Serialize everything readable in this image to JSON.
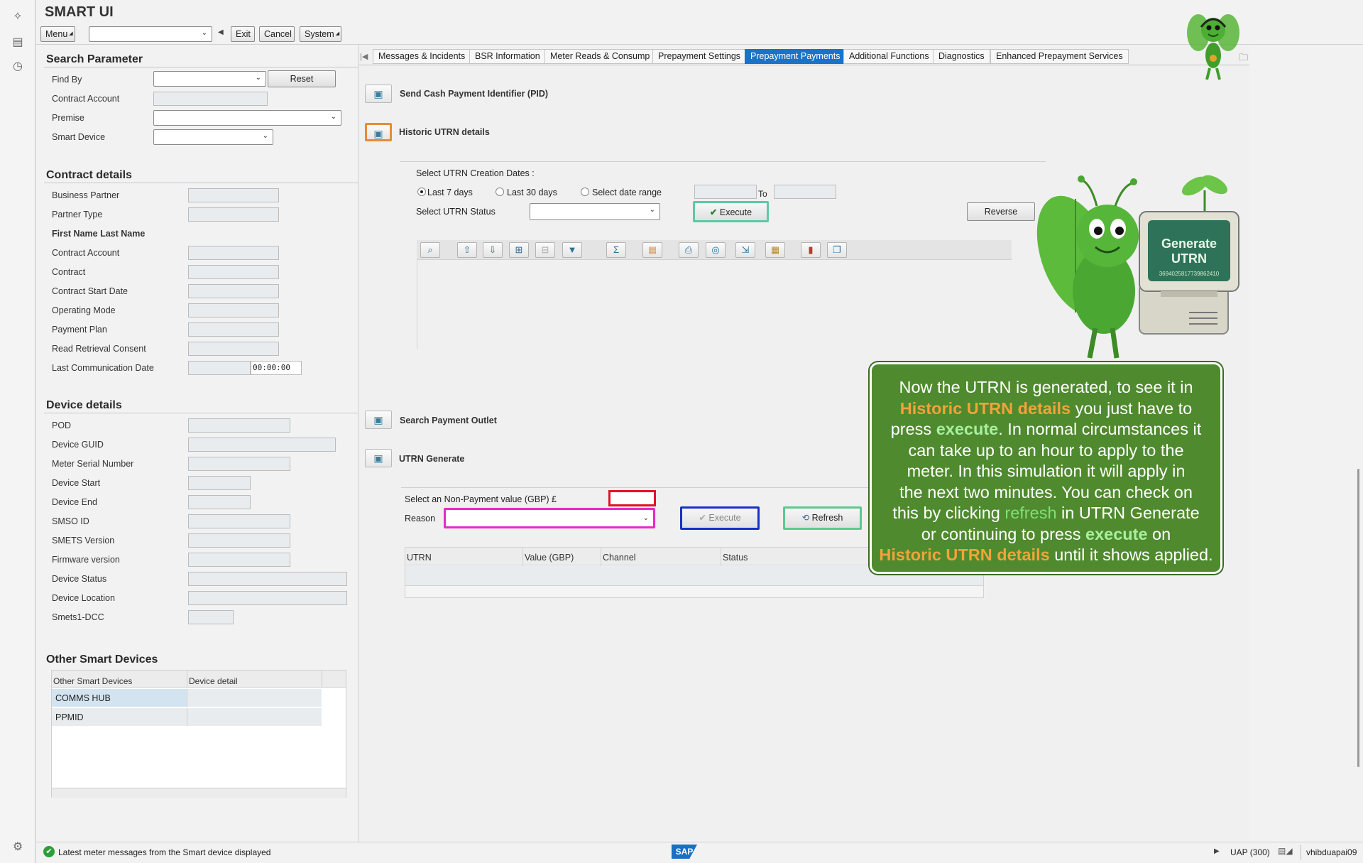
{
  "app": {
    "title": "SMART UI"
  },
  "toolbar": {
    "menu": "Menu",
    "exit": "Exit",
    "cancel": "Cancel",
    "system": "System"
  },
  "search_parameter": {
    "heading": "Search Parameter",
    "find_by": "Find By",
    "reset": "Reset",
    "contract_account": "Contract Account",
    "premise": "Premise",
    "smart_device": "Smart Device"
  },
  "contract_details": {
    "heading": "Contract details",
    "business_partner": "Business Partner",
    "partner_type": "Partner Type",
    "name": "First Name Last Name",
    "contract_account": "Contract Account",
    "contract": "Contract",
    "contract_start_date": "Contract Start Date",
    "operating_mode": "Operating Mode",
    "payment_plan": "Payment Plan",
    "read_retrieval_consent": "Read Retrieval Consent",
    "last_communication_date": "Last Communication Date",
    "last_comm_time": "00:00:00"
  },
  "device_details": {
    "heading": "Device details",
    "pod": "POD",
    "device_guid": "Device GUID",
    "meter_serial_number": "Meter Serial Number",
    "device_start": "Device Start",
    "device_end": "Device End",
    "smso_id": "SMSO ID",
    "smets_version": "SMETS Version",
    "firmware_version": "Firmware version",
    "device_status": "Device Status",
    "device_location": "Device Location",
    "smets1_dcc": "Smets1-DCC"
  },
  "other_devices": {
    "heading": "Other Smart Devices",
    "col1": "Other Smart Devices",
    "col2": "Device detail",
    "rows": [
      "COMMS HUB",
      "PPMID"
    ]
  },
  "tabs": [
    "Messages & Incidents",
    "BSR Information",
    "Meter Reads & Consump",
    "Prepayment Settings",
    "Prepayment Payments",
    "Additional Functions",
    "Diagnostics",
    "Enhanced Prepayment Services"
  ],
  "payments": {
    "send_cash": "Send Cash Payment Identifier (PID)",
    "historic": "Historic UTRN details",
    "select_dates": "Select UTRN Creation Dates :",
    "last7": "Last 7 days",
    "last30": "Last 30 days",
    "range": "Select date range",
    "to": "To",
    "select_status": "Select UTRN Status",
    "execute": "Execute",
    "reverse": "Reverse",
    "search_outlet": "Search Payment Outlet",
    "utrn_generate": "UTRN Generate",
    "non_payment": "Select an Non-Payment value (GBP) £",
    "reason": "Reason",
    "execute2": "Execute",
    "refresh": "Refresh",
    "cols": [
      "UTRN",
      "Value (GBP)",
      "Channel",
      "Status"
    ]
  },
  "mascot": {
    "screen_title": "Generate UTRN",
    "screen_number": "3694025817739862410"
  },
  "bubble": {
    "t1": "Now the UTRN is generated, to see it in",
    "t2a": "Historic UTRN details",
    "t2b": " you just have to",
    "t3a": "press ",
    "t3b": "execute",
    "t3c": ". In normal circumstances it",
    "t4": "can take up to an hour to apply to the",
    "t5": "meter. In this simulation it will apply in",
    "t6": "the next two minutes. You can check on",
    "t7a": "this by clicking ",
    "t7b": "refresh",
    "t7c": " in UTRN Generate",
    "t8a": "or continuing to press ",
    "t8b": "execute",
    "t8c": " on",
    "t9a": "Historic UTRN details",
    "t9b": " until it shows applied."
  },
  "status": {
    "message": "Latest meter messages from the Smart device displayed",
    "system": "UAP (300)",
    "user": "vhibduapai09",
    "logo": "SAP"
  }
}
